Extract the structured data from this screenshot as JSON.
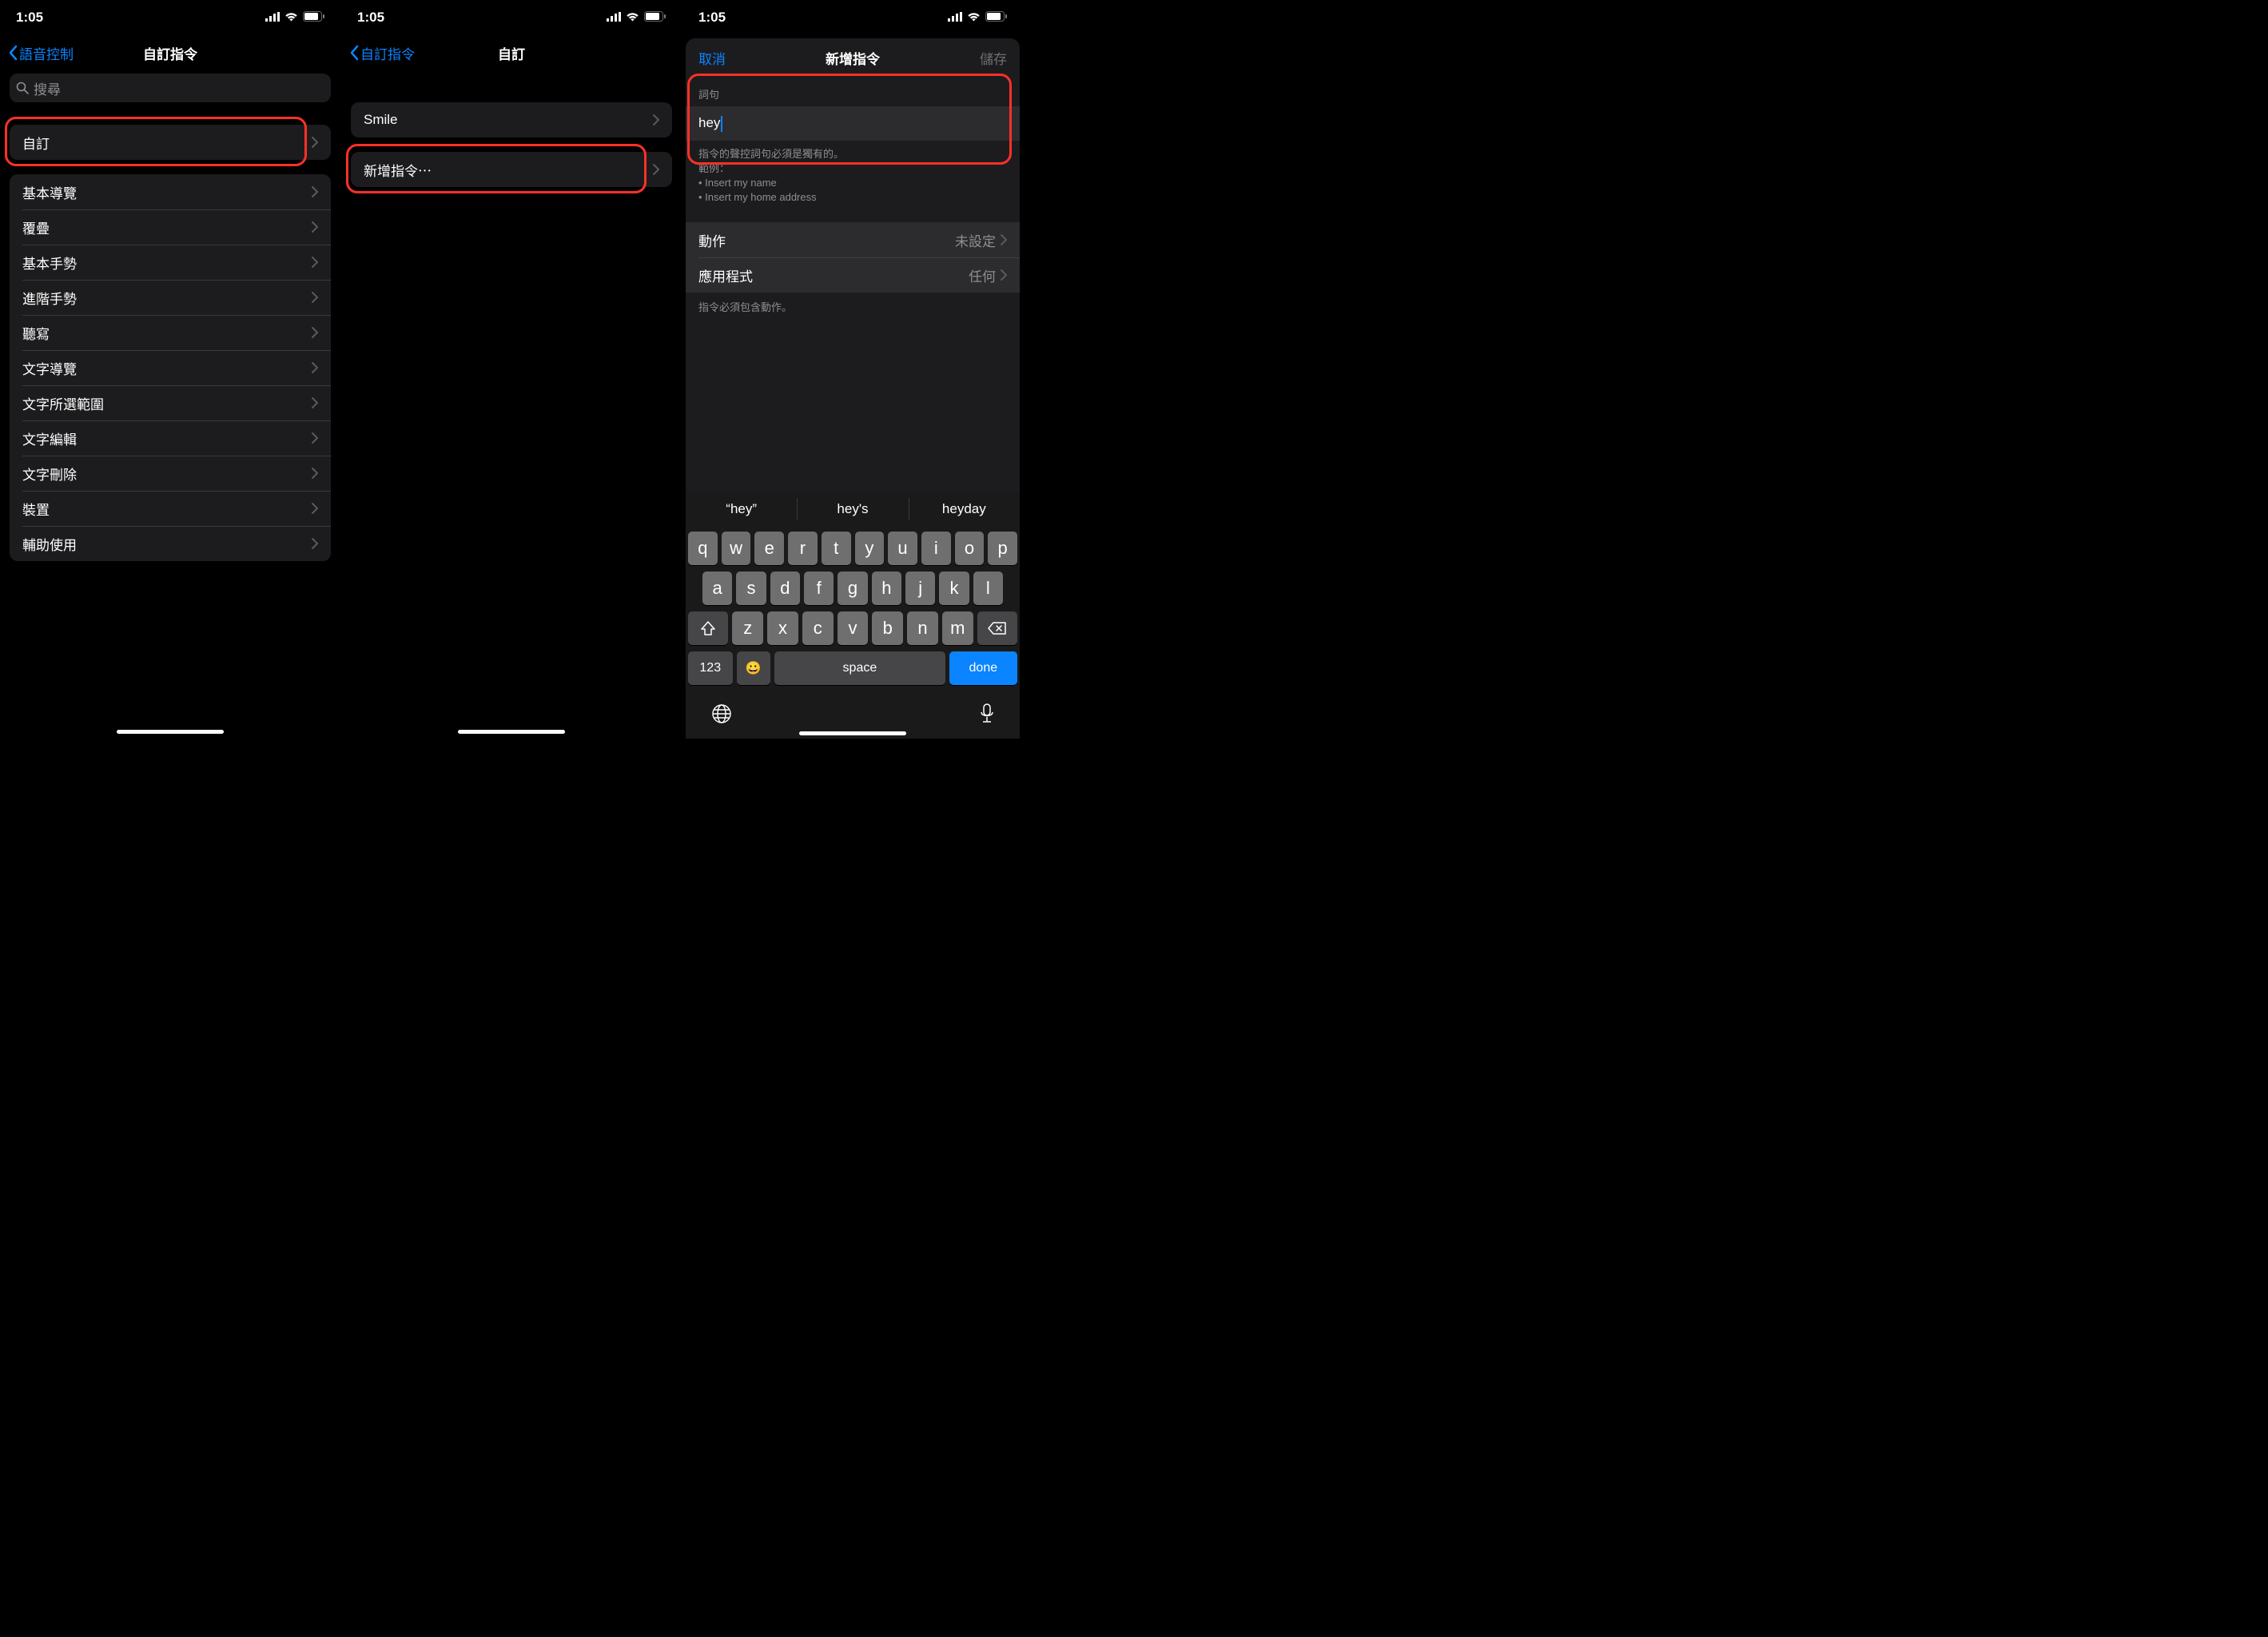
{
  "status": {
    "time": "1:05"
  },
  "screen1": {
    "back": "語音控制",
    "title": "自訂指令",
    "search_placeholder": "搜尋",
    "custom_row": "自訂",
    "categories": [
      "基本導覽",
      "覆疊",
      "基本手勢",
      "進階手勢",
      "聽寫",
      "文字導覽",
      "文字所選範圍",
      "文字編輯",
      "文字刪除",
      "裝置",
      "輔助使用"
    ]
  },
  "screen2": {
    "back": "自訂指令",
    "title": "自訂",
    "rows": [
      "Smile"
    ],
    "create": "新增指令⋯"
  },
  "screen3": {
    "cancel": "取消",
    "title": "新增指令",
    "save": "儲存",
    "phrase_header": "詞句",
    "phrase_value": "hey",
    "phrase_footer_line": "指令的聲控詞句必須是獨有的。",
    "phrase_footer_ex": "範例：",
    "phrase_footer_b1": "• Insert my name",
    "phrase_footer_b2": "• Insert my home address",
    "action_label": "動作",
    "action_value": "未設定",
    "app_label": "應用程式",
    "app_value": "任何",
    "note": "指令必須包含動作。",
    "suggestions": [
      "“hey”",
      "hey's",
      "heyday"
    ],
    "kb": {
      "r1": [
        "q",
        "w",
        "e",
        "r",
        "t",
        "y",
        "u",
        "i",
        "o",
        "p"
      ],
      "r2": [
        "a",
        "s",
        "d",
        "f",
        "g",
        "h",
        "j",
        "k",
        "l"
      ],
      "r3": [
        "z",
        "x",
        "c",
        "v",
        "b",
        "n",
        "m"
      ],
      "num": "123",
      "space": "space",
      "done": "done"
    }
  }
}
